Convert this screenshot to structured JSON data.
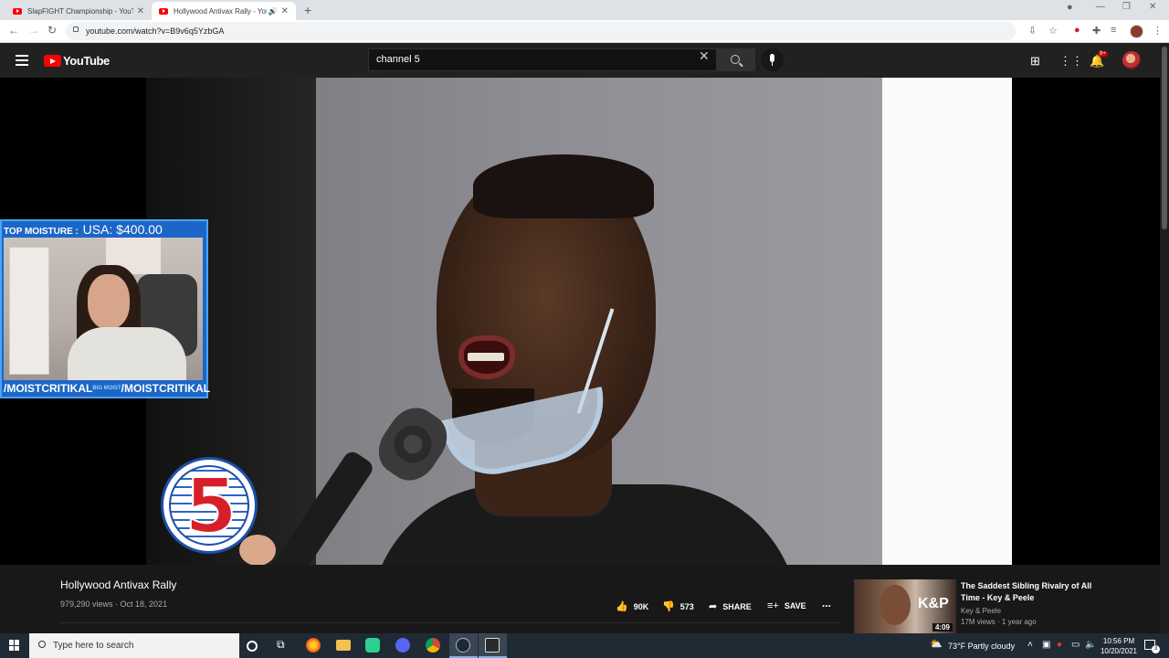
{
  "browser": {
    "tabs": [
      {
        "title": "SlapFIGHT Championship - YouTube",
        "active": false
      },
      {
        "title": "Hollywood Antivax Rally - YouTube",
        "active": true
      }
    ],
    "url": "youtube.com/watch?v=B9v6q5YzbGA",
    "window_controls": [
      "—",
      "❐",
      "✕"
    ]
  },
  "youtube_header": {
    "logo_text": "YouTube",
    "search_value": "channel 5",
    "notification_count": "9+"
  },
  "overlay": {
    "top_label": "TOP MOISTURE :",
    "top_amount": "USA: $400.00",
    "handle_left": "/MOISTCRITIKAL",
    "handle_right": "/MOISTCRITIKAL",
    "badge": "BIG MOIST",
    "channel_logo": "5"
  },
  "video": {
    "title": "Hollywood Antivax Rally",
    "views_date": "979,290 views · Oct 18, 2021",
    "likes": "90K",
    "dislikes": "573",
    "share_label": "SHARE",
    "save_label": "SAVE",
    "more_label": "..."
  },
  "recommended": {
    "title": "The Saddest Sibling Rivalry of All Time - Key & Peele",
    "channel": "Key & Peele",
    "meta": "17M views · 1 year ago",
    "duration": "4:09",
    "thumb_text": "K&P"
  },
  "taskbar": {
    "search_placeholder": "Type here to search",
    "weather": "73°F  Partly cloudy",
    "time": "10:56 PM",
    "date": "10/20/2021",
    "notif_count": "3"
  },
  "colors": {
    "youtube_red": "#ff0000",
    "overlay_blue": "#1c66c7",
    "channel5_red": "#d71f2a"
  }
}
